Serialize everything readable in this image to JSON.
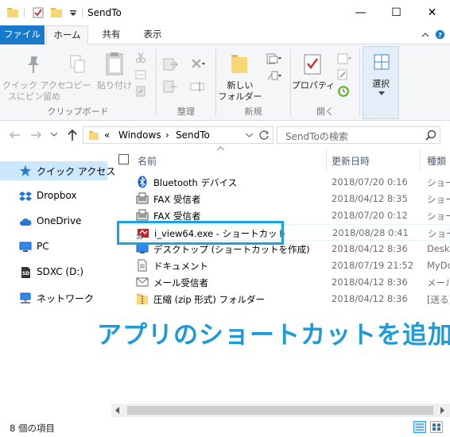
{
  "window": {
    "title": "SendTo",
    "minimize_glyph": "—",
    "maximize_glyph": "☐",
    "close_glyph": "✕"
  },
  "ribbon_tabs": {
    "file": "ファイル",
    "home": "ホーム",
    "share": "共有",
    "view": "表示"
  },
  "ribbon": {
    "clipboard": {
      "pin_label_line1": "クイック アクセ",
      "pin_label_line2": "スにピン留め",
      "copy_label": "コピー",
      "paste_label": "貼り付け",
      "group_label": "クリップボード"
    },
    "organize": {
      "group_label": "整理"
    },
    "new": {
      "new_folder_line1": "新しい",
      "new_folder_line2": "フォルダー",
      "group_label": "新規"
    },
    "open": {
      "properties_label": "プロパティ",
      "group_label": "開く"
    },
    "select": {
      "select_label": "選択"
    }
  },
  "address": {
    "overflow": "«",
    "crumb1": "Windows",
    "sep": "›",
    "crumb2": "SendTo",
    "search_placeholder": "SendToの検索"
  },
  "nav": {
    "items": [
      {
        "label": "クイック アクセス"
      },
      {
        "label": "Dropbox"
      },
      {
        "label": "OneDrive"
      },
      {
        "label": "PC"
      },
      {
        "label": "SDXC (D:)"
      },
      {
        "label": "ネットワーク"
      }
    ]
  },
  "columns": {
    "name": "名前",
    "date": "更新日時",
    "type": "種類"
  },
  "files": [
    {
      "name": "Bluetooth デバイス",
      "date": "2018/07/20 0:16",
      "type": "ショー"
    },
    {
      "name": "FAX 受信者",
      "date": "2018/04/12 8:35",
      "type": "ショー"
    },
    {
      "name": "FAX 受信者",
      "date": "2018/07/20 0:12",
      "type": "ショー"
    },
    {
      "name": "i_view64.exe - ショートカット",
      "date": "2018/08/28 0:41",
      "type": "ショー"
    },
    {
      "name": "デスクトップ (ショートカットを作成)",
      "date": "2018/04/12 8:36",
      "type": "Desk"
    },
    {
      "name": "ドキュメント",
      "date": "2018/07/19 21:52",
      "type": "MyDo"
    },
    {
      "name": "メール受信者",
      "date": "2018/04/12 8:36",
      "type": "メール"
    },
    {
      "name": "圧縮 (zip 形式) フォルダー",
      "date": "2018/04/12 8:36",
      "type": "[送る]"
    }
  ],
  "overlay_caption": "アプリのショートカットを追加",
  "status": {
    "item_count": "8 個の項目"
  },
  "colors": {
    "accent": "#1979ca",
    "caption": "#1d9ad9",
    "callout_border": "#1ea0e0"
  }
}
